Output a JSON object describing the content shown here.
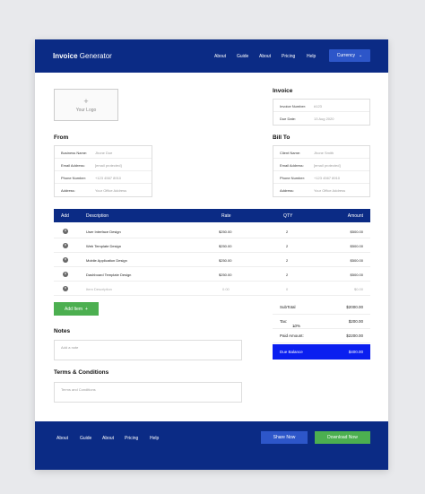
{
  "header": {
    "brand_bold": "Invoice",
    "brand_rest": " Generator",
    "nav": [
      "About",
      "Guide",
      "About",
      "Pricing",
      "Help"
    ],
    "currency_label": "Currency",
    "currency_icon": "chevron-down-icon"
  },
  "logo": {
    "plus": "+",
    "label": "Your Logo"
  },
  "invoice": {
    "heading": "Invoice",
    "rows": [
      {
        "label": "Invoice Number:",
        "value": "#123"
      },
      {
        "label": "Due Date:",
        "value": "13 Aug 2020"
      }
    ]
  },
  "from": {
    "heading": "From",
    "rows": [
      {
        "label": "Business Name:",
        "value": "Jhone Doe"
      },
      {
        "label": "Email Address:",
        "value": "[email protected]"
      },
      {
        "label": "Phone Number:",
        "value": "+123 4567 8910"
      },
      {
        "label": "Address:",
        "value": "Your Office Address"
      }
    ]
  },
  "bill_to": {
    "heading": "Bill To",
    "rows": [
      {
        "label": "Client Name:",
        "value": "Jhone Smith"
      },
      {
        "label": "Email Address:",
        "value": "[email protected]"
      },
      {
        "label": "Phone Number:",
        "value": "+123 4567 8910"
      },
      {
        "label": "Address:",
        "value": "Your Office Address"
      }
    ]
  },
  "table": {
    "headers": {
      "add": "Add",
      "description": "Description",
      "rate": "Rate",
      "qty": "QTY",
      "amount": "Amount"
    },
    "rows": [
      {
        "description": "User Interface Design",
        "rate": "$250.00",
        "qty": "2",
        "amount": "$500.00"
      },
      {
        "description": "Web Template Design",
        "rate": "$250.00",
        "qty": "2",
        "amount": "$500.00"
      },
      {
        "description": "Mobile Application Design",
        "rate": "$250.00",
        "qty": "2",
        "amount": "$500.00"
      },
      {
        "description": "Dashboard Template Design",
        "rate": "$250.00",
        "qty": "2",
        "amount": "$500.00"
      },
      {
        "description": "Item Description",
        "rate": "0.00",
        "qty": "0",
        "amount": "$0.00"
      }
    ],
    "add_item_label": "Add Item",
    "add_item_icon": "plus-icon"
  },
  "summary": {
    "subtotal_label": "SubTotal",
    "subtotal_value": "$2000.00",
    "tax_label": "Tax:",
    "tax_rate": "10%",
    "tax_value": "$200.00",
    "paid_label": "Paid Amount:",
    "paid_value": "$2200.00",
    "due_label": "Due Balance",
    "due_value": "$400.00"
  },
  "notes": {
    "heading": "Notes",
    "placeholder": "Add a note"
  },
  "terms": {
    "heading": "Terms & Conditions",
    "placeholder": "Terms and Conditions"
  },
  "footer": {
    "nav": [
      "About",
      "Guide",
      "About",
      "Pricing",
      "Help"
    ],
    "share_label": "Share Now",
    "download_label": "Download Now"
  }
}
